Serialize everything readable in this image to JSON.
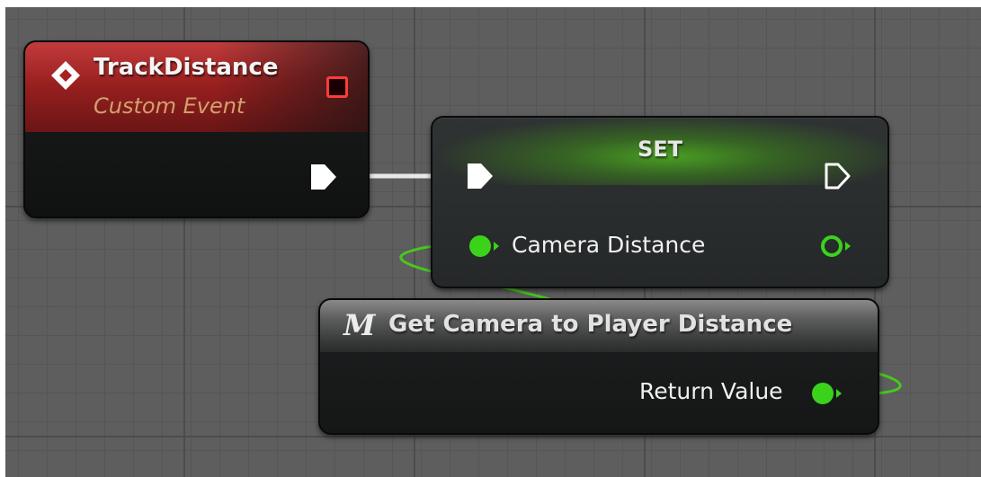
{
  "event_node": {
    "title": "TrackDistance",
    "subtitle": "Custom Event",
    "header_color": "#b22a2a",
    "icon": "event-diamond-icon"
  },
  "set_node": {
    "title": "SET",
    "header_color": "#4aa422",
    "variable_label": "Camera Distance"
  },
  "function_node": {
    "icon_glyph": "M",
    "icon": "member-function-icon",
    "title": "Get Camera to Player Distance",
    "output_label": "Return Value"
  },
  "colors": {
    "float_pin": "#3bd21c",
    "exec_pin": "#ffffff",
    "delegate_pin": "#ff3b3b"
  }
}
